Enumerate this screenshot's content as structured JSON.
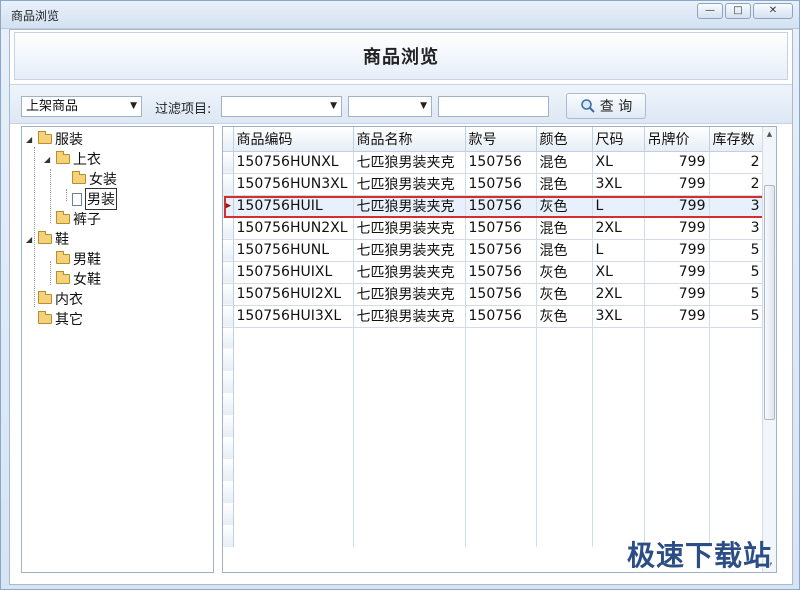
{
  "window": {
    "title": "商品浏览",
    "minimize_label": "—",
    "maximize_label": "□",
    "close_label": "✕"
  },
  "header": {
    "title": "商品浏览"
  },
  "toolbar": {
    "status_select": "上架商品",
    "filter_label": "过滤项目:",
    "filter_field_value": "",
    "filter_op_value": "",
    "filter_value": "",
    "query_label": "查 询"
  },
  "tree": {
    "nodes": [
      {
        "label": "服装"
      },
      {
        "label": "上衣"
      },
      {
        "label": "女装"
      },
      {
        "label": "男装"
      },
      {
        "label": "裤子"
      },
      {
        "label": "鞋"
      },
      {
        "label": "男鞋"
      },
      {
        "label": "女鞋"
      },
      {
        "label": "内衣"
      },
      {
        "label": "其它"
      }
    ]
  },
  "grid": {
    "columns": [
      "商品编码",
      "商品名称",
      "款号",
      "颜色",
      "尺码",
      "吊牌价",
      "库存数"
    ],
    "rows": [
      [
        "150756HUNXL",
        "七匹狼男装夹克",
        "150756",
        "混色",
        "XL",
        "799",
        "2"
      ],
      [
        "150756HUN3XL",
        "七匹狼男装夹克",
        "150756",
        "混色",
        "3XL",
        "799",
        "2"
      ],
      [
        "150756HUIL",
        "七匹狼男装夹克",
        "150756",
        "灰色",
        "L",
        "799",
        "3"
      ],
      [
        "150756HUN2XL",
        "七匹狼男装夹克",
        "150756",
        "混色",
        "2XL",
        "799",
        "3"
      ],
      [
        "150756HUNL",
        "七匹狼男装夹克",
        "150756",
        "混色",
        "L",
        "799",
        "5"
      ],
      [
        "150756HUIXL",
        "七匹狼男装夹克",
        "150756",
        "灰色",
        "XL",
        "799",
        "5"
      ],
      [
        "150756HUI2XL",
        "七匹狼男装夹克",
        "150756",
        "灰色",
        "2XL",
        "799",
        "5"
      ],
      [
        "150756HUI3XL",
        "七匹狼男装夹克",
        "150756",
        "灰色",
        "3XL",
        "799",
        "5"
      ]
    ],
    "current_row_marker": "▶"
  },
  "watermark": "极速下载站",
  "colors": {
    "highlight_border": "#d32f2f",
    "window_bg": "#d6e4f3"
  },
  "icons": {
    "query": "search-icon",
    "folder": "folder-icon",
    "document": "document-icon"
  }
}
